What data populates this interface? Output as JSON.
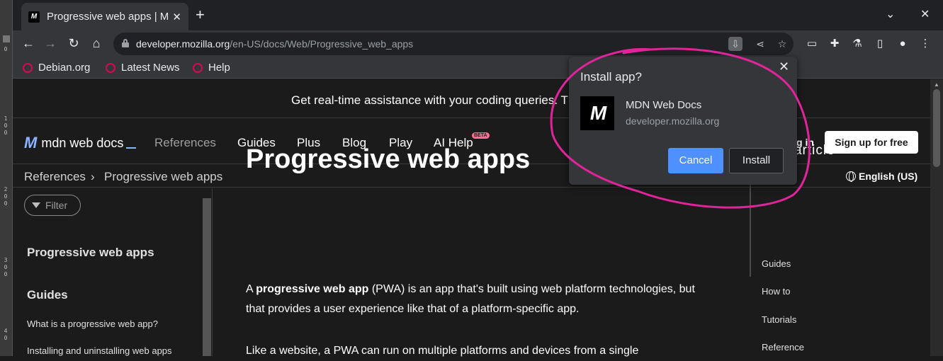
{
  "ruler": {
    "labels": [
      "0",
      "1",
      "0",
      "0",
      "2",
      "0",
      "0",
      "3",
      "0",
      "0",
      "4",
      "0"
    ]
  },
  "tab": {
    "favicon": "M",
    "title": "Progressive web apps | M",
    "close": "✕"
  },
  "newtab": "+",
  "window_controls": {
    "dropdown": "⌄",
    "close": "✕"
  },
  "toolbar": {
    "back": "←",
    "forward": "→",
    "reload": "↻",
    "home": "⌂",
    "url_host": "developer.mozilla.org",
    "url_path": "/en-US/docs/Web/Progressive_web_apps",
    "install": "⇩",
    "share": "⋖",
    "star": "☆",
    "ext_chat": "▭",
    "ext_puzzle": "✚",
    "ext_lab": "⚗",
    "ext_panel": "▯",
    "ext_profile": "●",
    "menu": "⋮"
  },
  "bookmarks": [
    {
      "label": "Debian.org"
    },
    {
      "label": "Latest News"
    },
    {
      "label": "Help"
    }
  ],
  "banner": {
    "text": "Get real-time assistance with your coding queries. T"
  },
  "mdn_nav": {
    "logo_mark": "M",
    "logo_text": "mdn web docs",
    "items": [
      "References",
      "Guides",
      "Plus",
      "Blog",
      "Play",
      "AI Help"
    ],
    "beta": "BETA",
    "login": "g in",
    "signup": "Sign up for free"
  },
  "breadcrumbs": {
    "first": "References",
    "separator": "›",
    "second": "Progressive web apps",
    "language": "English (US)"
  },
  "sidebar": {
    "filter": "Filter",
    "heading1": "Progressive web apps",
    "heading2": "Guides",
    "links": [
      "What is a progressive web app?",
      "Installing and uninstalling web apps"
    ]
  },
  "article": {
    "title": "Progressive web apps",
    "p1_prefix": "A ",
    "p1_bold": "progressive web app",
    "p1_rest": " (PWA) is an app that's built using web platform technologies, but that provides a user experience like that of a platform-specific app.",
    "p2": "Like a website, a PWA can run on multiple platforms and devices from a single"
  },
  "toc": {
    "title": "In this article",
    "items": [
      "Guides",
      "How to",
      "Tutorials",
      "Reference"
    ]
  },
  "popup": {
    "title": "Install app?",
    "close": "✕",
    "app_icon": "M",
    "app_name": "MDN Web Docs",
    "app_host": "developer.mozilla.org",
    "cancel": "Cancel",
    "install": "Install"
  },
  "colors": {
    "annotation": "#e0249a",
    "primary_button": "#4d90fe",
    "beta": "#ff6e92"
  }
}
